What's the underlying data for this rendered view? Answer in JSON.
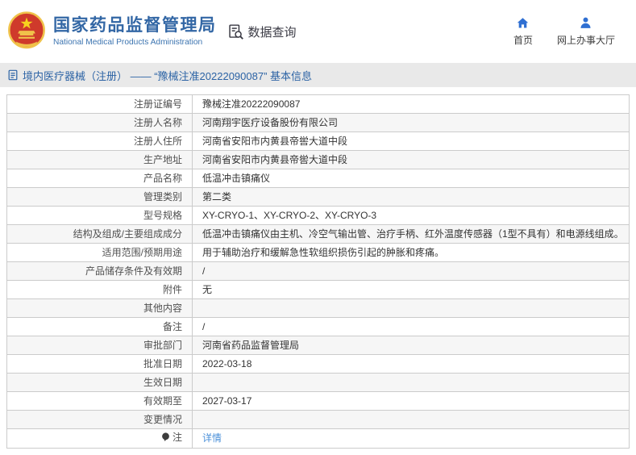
{
  "header": {
    "org_name_cn": "国家药品监督管理局",
    "org_name_en": "National Medical Products Administration",
    "section_label": "数据查询",
    "nav": [
      {
        "label": "首页",
        "icon": "home-icon"
      },
      {
        "label": "网上办事大厅",
        "icon": "person-icon"
      }
    ]
  },
  "breadcrumb": {
    "text": "境内医疗器械（注册） —— “豫械注准20222090087” 基本信息"
  },
  "table": {
    "rows": [
      {
        "label": "注册证编号",
        "value": "豫械注准20222090087"
      },
      {
        "label": "注册人名称",
        "value": "河南翔宇医疗设备股份有限公司"
      },
      {
        "label": "注册人住所",
        "value": "河南省安阳市内黄县帝喾大道中段"
      },
      {
        "label": "生产地址",
        "value": "河南省安阳市内黄县帝喾大道中段"
      },
      {
        "label": "产品名称",
        "value": "低温冲击镇痛仪"
      },
      {
        "label": "管理类别",
        "value": "第二类"
      },
      {
        "label": "型号规格",
        "value": "XY-CRYO-1、XY-CRYO-2、XY-CRYO-3"
      },
      {
        "label": "结构及组成/主要组成成分",
        "value": "低温冲击镇痛仪由主机、冷空气输出管、治疗手柄、红外温度传感器（1型不具有）和电源线组成。"
      },
      {
        "label": "适用范围/预期用途",
        "value": "用于辅助治疗和缓解急性软组织损伤引起的肿胀和疼痛。"
      },
      {
        "label": "产品储存条件及有效期",
        "value": "/"
      },
      {
        "label": "附件",
        "value": "无"
      },
      {
        "label": "其他内容",
        "value": ""
      },
      {
        "label": "备注",
        "value": "/"
      },
      {
        "label": "审批部门",
        "value": "河南省药品监督管理局"
      },
      {
        "label": "批准日期",
        "value": "2022-03-18"
      },
      {
        "label": "生效日期",
        "value": ""
      },
      {
        "label": "有效期至",
        "value": "2027-03-17"
      },
      {
        "label": "变更情况",
        "value": ""
      },
      {
        "label": "注",
        "value": "详情",
        "link": true,
        "label_icon": "note-icon"
      }
    ]
  },
  "colors": {
    "brand_blue": "#3367a5",
    "nav_icon_blue": "#2f6fd2",
    "breadcrumb_bg": "#e9e9e9",
    "breadcrumb_text": "#2c63a5",
    "alt_row_bg": "#f6f6f6",
    "table_border": "#cbcbcb",
    "link_blue": "#4a90d9",
    "emblem_red": "#cf3a2b",
    "emblem_gold": "#f0c24a"
  }
}
